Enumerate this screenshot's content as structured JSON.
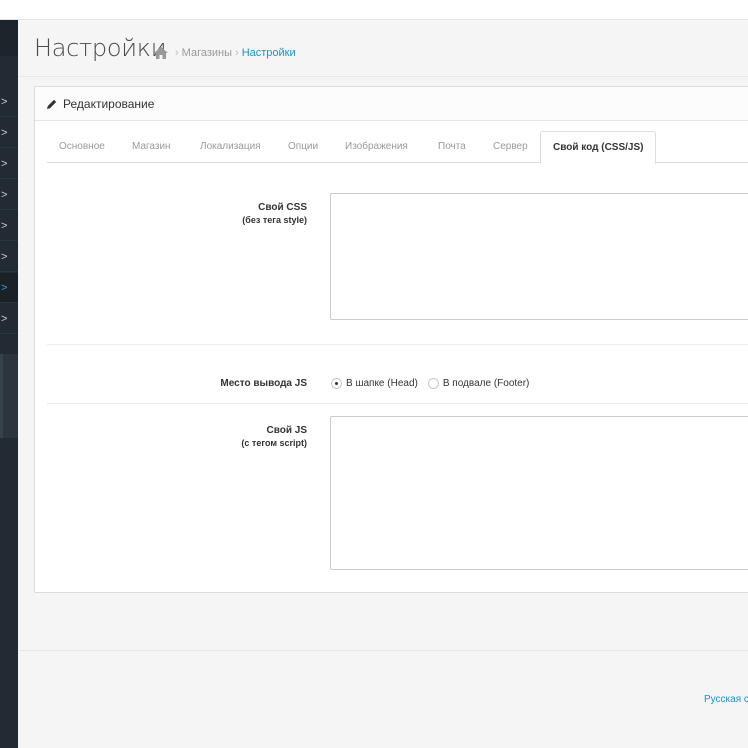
{
  "header": {
    "title": "Настройки",
    "breadcrumb": [
      "Магазины",
      "Настройки"
    ]
  },
  "sidebar": {
    "items": [
      ">",
      ">",
      ">",
      ">",
      ">",
      ">",
      ">",
      ">"
    ]
  },
  "panel": {
    "title": "Редактирование",
    "tabs": [
      "Основное",
      "Магазин",
      "Локализация",
      "Опции",
      "Изображения",
      "Почта",
      "Сервер",
      "Свой код (CSS/JS)"
    ],
    "active_tab": "Свой код (CSS/JS)"
  },
  "form": {
    "css_label": "Свой CSS",
    "css_sublabel": "(без тега style)",
    "css_value": "",
    "js_position_label": "Место вывода JS",
    "js_position_options": [
      "В шапке (Head)",
      "В подвале (Footer)"
    ],
    "js_position_selected": "В шапке (Head)",
    "js_label": "Свой JS",
    "js_sublabel": "(с тегом script)",
    "js_value": ""
  },
  "footer": {
    "language_link": "Русская сб"
  },
  "colors": {
    "accent": "#1e91cf",
    "sidebar": "#222b33"
  }
}
